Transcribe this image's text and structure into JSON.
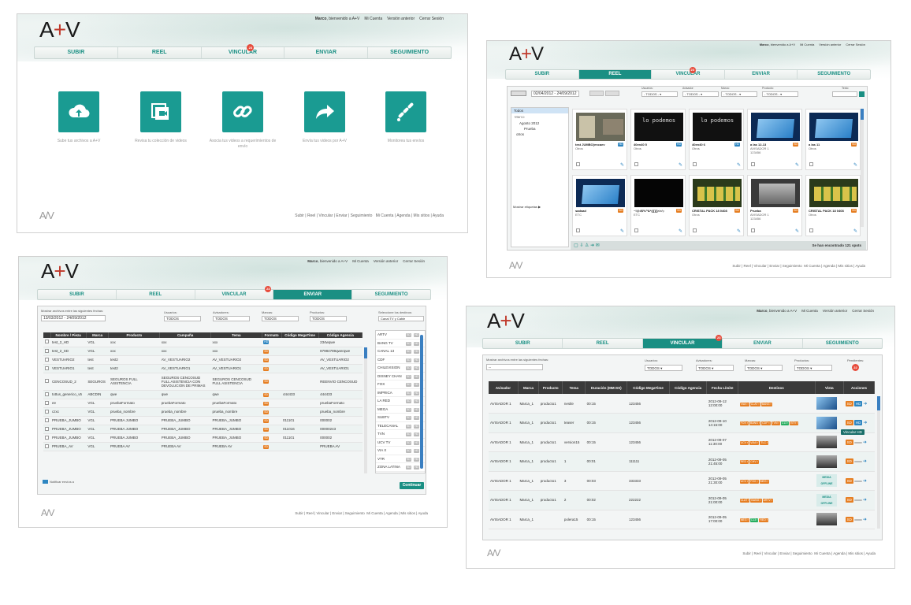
{
  "user": {
    "greeting_user": "Marco",
    "greeting_rest": ", bienvenido a A+V",
    "account": "Mi Cuenta",
    "previous": "Versión anterior",
    "logout": "Cerrar Sesión"
  },
  "brand": {
    "logo_a": "A",
    "logo_plus": "+",
    "logo_v": "V"
  },
  "nav": {
    "subir": "SUBIR",
    "reel": "REEL",
    "vincular": "VINCULAR",
    "enviar": "ENVIAR",
    "seguimiento": "SEGUIMIENTO",
    "badge": "23"
  },
  "footer": {
    "links": "Subir  |  Reel  |  Vincular  |  Enviar  |  Seguimiento",
    "links2": "Mi Cuenta  |  Agenda  |  Mis sitios  |  Ayuda"
  },
  "home": {
    "tiles": [
      {
        "icon": "cloud-upload-icon",
        "caption": "Sube tus archivos a A+V"
      },
      {
        "icon": "video-collection-icon",
        "caption": "Revisa tu colección de videos"
      },
      {
        "icon": "link-icon",
        "caption": "Asocia tus videos a requerimientos de envío"
      },
      {
        "icon": "share-arrow-icon",
        "caption": "Envía tus videos por A+V"
      },
      {
        "icon": "tracking-icon",
        "caption": "Monitorea tus envíos"
      }
    ]
  },
  "reel": {
    "date_range": "02/04/2012 - 24/09/2012",
    "filters": [
      {
        "label": "Usuarios:",
        "value": "- TODOS -"
      },
      {
        "label": "Avisador:",
        "value": "- TODOS -"
      },
      {
        "label": "Marca:",
        "value": "- TODOS -"
      },
      {
        "label": "Producto:",
        "value": "- TODOS -"
      }
    ],
    "search_label": "Texto:",
    "tree": {
      "root": "Todos",
      "user": "Marco",
      "folder": "Agosto 2012",
      "sub": "Prueba",
      "other": "otros"
    },
    "tags": "Mostrar etiquetas ▶",
    "videos": [
      {
        "title": "test JUMBO(encaev",
        "sub": "Otros",
        "fmt": "HD",
        "kind": "room"
      },
      {
        "title": "40en40 5",
        "sub": "Otros",
        "fmt": "HD",
        "kind": "text"
      },
      {
        "title": "40en40 6",
        "sub": "Otros",
        "fmt": "HD",
        "kind": "text"
      },
      {
        "title": "a las 12-13",
        "sub": "AVISADOR 1\n123456",
        "fmt": "SD",
        "kind": "blue"
      },
      {
        "title": "a las 11",
        "sub": "Otros",
        "fmt": "SD",
        "kind": "blue"
      },
      {
        "title": "sadsad",
        "sub": "ETC",
        "fmt": "SD",
        "kind": "blue"
      },
      {
        "title": "~!@#$%^&*()[]{}<>/;:",
        "sub": "ETC",
        "fmt": "SD",
        "kind": "dark"
      },
      {
        "title": "CRISTAL PACK 18 0408",
        "sub": "Otros",
        "fmt": "SD",
        "kind": "cans"
      },
      {
        "title": "Prueba",
        "sub": "AVISADOR 1\n123456",
        "fmt": "SD",
        "kind": "gray"
      },
      {
        "title": "CRISTAL PACK 18 0408",
        "sub": "Otros",
        "fmt": "SD",
        "kind": "cans"
      }
    ],
    "thumb_text": "lo podemos",
    "found": "Se han encontrado 121 spots"
  },
  "enviar": {
    "dates_label": "Mostrar archivos entre las siguientes fechas:",
    "date_range": "13/03/2012 - 24/09/2012",
    "filters": [
      {
        "label": "Usuarios:",
        "value": "TODOS"
      },
      {
        "label": "Avisadores:",
        "value": "TODOS"
      },
      {
        "label": "Marcas:",
        "value": "TODOS"
      },
      {
        "label": "Productos:",
        "value": "TODOS"
      }
    ],
    "dest_label": "Seleccione los destinos:",
    "dest_value": "Canal TV y Cable",
    "columns": [
      "Nombre / Pieza",
      "Marca",
      "Producto",
      "Campaña",
      "Tema",
      "Formato",
      "Código MegaTime",
      "Código Agencia"
    ],
    "rows": [
      [
        "test_2_HD",
        "VGL",
        "xxx",
        "xxx",
        "xxx",
        "HD",
        "",
        "234wqwe"
      ],
      [
        "test_2_SD",
        "VGL",
        "xxx",
        "xxx",
        "xxx",
        "SD",
        "",
        "87984789qwerqwe"
      ],
      [
        "VESTUARIO2",
        "test",
        "test2",
        "AV_VESTUARIO2",
        "AV_VESTUARIO2",
        "SD",
        "",
        "AV_VESTUARIO2"
      ],
      [
        "VESTUARIO1",
        "test",
        "test2",
        "AV_VESTUARIO1",
        "AV_VESTUARIO1",
        "SD",
        "",
        "AV_VESTUARIO1"
      ],
      [
        "CENCOSUD_2",
        "SEGUROS",
        "SEGUROS FULL ASISTENCIA",
        "SEGUROS CENCOSUD FULL ASISTENCIA CON DEVOLUCION DE PRIMAS",
        "SEGUROS CENCOSUD FULL ASISTENCIA",
        "SD",
        "",
        "REENVIO CENCOSUD"
      ],
      [
        "tottus_generico_v5",
        "ABCDIN",
        "qwe",
        "qwe",
        "qwe",
        "SD",
        "444433",
        "444433"
      ],
      [
        "ee",
        "VGL",
        "pruebaFormato",
        "pruebaFormato",
        "pruebaFormato",
        "SD",
        "",
        "pruebaFormato"
      ],
      [
        "czxc",
        "VGL",
        "prueba_nombre",
        "prueba_nombre",
        "prueba_nombre",
        "SD",
        "",
        "prueba_nombre"
      ],
      [
        "PRUEBA_JUMBO",
        "VGL",
        "PRUEBA JUMBO",
        "PRUEBA_JUMBO",
        "PRUEBA_JUMBO",
        "SD",
        "011101",
        "000002"
      ],
      [
        "PRUEBA_JUMBO",
        "VGL",
        "PRUEBA JUMBO",
        "PRUEBA_JUMBO",
        "PRUEBA_JUMBO",
        "SD",
        "011016",
        "00000243"
      ],
      [
        "PRUEBA_JUMBO",
        "VGL",
        "PRUEBA JUMBO",
        "PRUEBA_JUMBO",
        "PRUEBA_JUMBO",
        "SD",
        "011101",
        "000002"
      ],
      [
        "PRUEBA_AV",
        "VGL",
        "PRUEBA AV",
        "PRUEBA AV",
        "PRUEBA AV",
        "SD",
        "",
        "PRUEBA AV"
      ]
    ],
    "destinations": [
      "ARTV",
      "BANG TV",
      "CANAL 13",
      "CDF",
      "CHILEVISION",
      "DISNEY CHAN",
      "FOX",
      "IMPRICA",
      "LA RED",
      "MEGA",
      "SUBTV",
      "TELECANAL",
      "TVN",
      "UCV TV",
      "VIA X",
      "VTR",
      "ZONA LATINA"
    ],
    "notify": "Notificar envíos a",
    "continue": "Continuar"
  },
  "vincular": {
    "dates_label": "Mostrar archivos entre las siguientes fechas:",
    "date_value": "--",
    "filters": [
      {
        "label": "Usuarios:",
        "value": "TODOS"
      },
      {
        "label": "Avisadores:",
        "value": "TODOS"
      },
      {
        "label": "Marcas:",
        "value": "TODOS"
      },
      {
        "label": "Productos:",
        "value": "TODOS"
      }
    ],
    "pending_label": "Pendientes:",
    "pending": "22",
    "columns": [
      "Avisador",
      "Marca",
      "Producto",
      "Tema",
      "Duración (MM:SS)",
      "Código MegaTime",
      "Código Agencia",
      "Fecha Límite",
      "Destinos",
      "Vista",
      "Acciones"
    ],
    "rows": [
      {
        "a": "AVISADOR 1",
        "m": "Marca_1",
        "p": "producto1",
        "t": "nestle",
        "d": "00:15",
        "c": "123456",
        "f": "2012-09-12\n12:00:00",
        "dest": [
          "VIAX",
          "CLAT",
          "BANG"
        ],
        "v": "blue"
      },
      {
        "a": "AVISADOR 1",
        "m": "Marca_1",
        "p": "producto1",
        "t": "teaser",
        "d": "00:15",
        "c": "123456",
        "f": "2012-09-10\n14:15:00",
        "dest": [
          "FOX",
          "BANG",
          "CDF",
          "TVN",
          "C13",
          "BTV"
        ],
        "v": "blue"
      },
      {
        "a": "AVISADOR 1",
        "m": "Marca_1",
        "p": "producto1",
        "t": "version15",
        "d": "00:15",
        "c": "123456",
        "f": "2012-09-07\n11:30:00",
        "dest": [
          "UCV",
          "VIAX",
          "TLC"
        ],
        "v": "gray"
      },
      {
        "a": "AVISADOR 1",
        "m": "Marca_1",
        "p": "producto1",
        "t": "1",
        "d": "00:01",
        "c": "111111",
        "f": "2012-09-05\n21:45:00",
        "dest": [
          "RED",
          "CHV"
        ],
        "v": "gray"
      },
      {
        "a": "AVISADOR 1",
        "m": "Marca_1",
        "p": "producto1",
        "t": "3",
        "d": "00:03",
        "c": "333333",
        "f": "2012-09-05\n21:30:00",
        "dest": [
          "UCV",
          "FOX",
          "MEG"
        ],
        "v": "offline"
      },
      {
        "a": "AVISADOR 1",
        "m": "Marca_1",
        "p": "producto1",
        "t": "2",
        "d": "00:02",
        "c": "222222",
        "f": "2012-09-05\n21:00:00",
        "dest": [
          "CLAT",
          "BANG",
          "ARTV"
        ],
        "v": "offline"
      },
      {
        "a": "AVISADOR 1",
        "m": "Marca_1",
        "p": "",
        "t": "polera15",
        "d": "00:15",
        "c": "123456",
        "f": "2012-09-05\n17:00:00",
        "dest": [
          "MEG",
          "C13",
          "RED"
        ],
        "v": "gray"
      }
    ],
    "offline_text": "MEDIA OFFLINE",
    "tooltip": "Vincular HD",
    "sd": "SD",
    "hd": "HD"
  }
}
